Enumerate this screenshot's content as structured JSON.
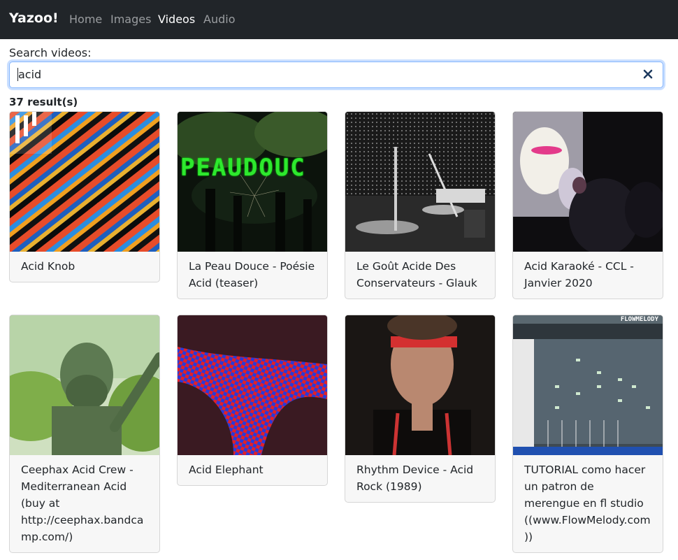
{
  "nav": {
    "brand": "Yazoo!",
    "links": [
      {
        "label": "Home",
        "active": false
      },
      {
        "label": "Images",
        "active": false
      },
      {
        "label": "Videos",
        "active": true
      },
      {
        "label": "Audio",
        "active": false
      }
    ]
  },
  "search": {
    "label": "Search videos:",
    "value": "acid",
    "clear_icon": "close-icon"
  },
  "results": {
    "count_text": "37 result(s)",
    "items": [
      {
        "title": "Acid Knob"
      },
      {
        "title": "La Peau Douce - Poésie Acid (teaser)"
      },
      {
        "title": "Le Goût Acide Des Conservateurs - Glauk"
      },
      {
        "title": "Acid Karaoké - CCL - Janvier 2020"
      },
      {
        "title": "Ceephax Acid Crew - Mediterranean Acid (buy at http://ceephax.bandcamp.com/)"
      },
      {
        "title": "Acid Elephant"
      },
      {
        "title": "Rhythm Device - Acid Rock (1989)"
      },
      {
        "title": "TUTORIAL como hacer un patron de merengue en fl studio ((www.FlowMelody.com))"
      }
    ],
    "thumb_overlay_text": "PEAUDOUC",
    "fl_logo_text": "FLOWMELODY"
  },
  "colors": {
    "navbar_bg": "#212529",
    "nav_active": "#ffffff",
    "nav_inactive": "#9a9da0",
    "focus_border": "#86b7fe",
    "clear_icon": "#1e3a5f",
    "card_bg": "#f7f7f7"
  }
}
